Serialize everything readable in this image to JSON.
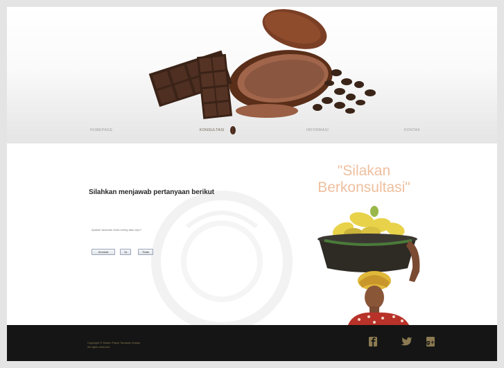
{
  "header": {
    "nav": [
      {
        "label": "Homepage"
      },
      {
        "label": "Konsultasi"
      },
      {
        "label": "Informasi"
      },
      {
        "label": "Kontak"
      }
    ],
    "active_index": 1
  },
  "main": {
    "question_title": "Silahkan menjawab pertanyaan berikut",
    "question_text": "Apakah tanaman Anda kering atau layu?",
    "buttons": {
      "back_label": "Kembali",
      "yes_label": "Ya",
      "no_label": "Tidak"
    },
    "promo": {
      "title": "\"Silakan Berkonsultasi\""
    }
  },
  "footer": {
    "copyright": "Copyright © Sistem Pakar Tanaman Kakao",
    "credit": "All rights reserved"
  },
  "colors": {
    "accent": "#efbf9e",
    "footer_bg": "#151515",
    "footer_text": "#8b7a52"
  },
  "icons": {
    "social": [
      "facebook-icon",
      "twitter-icon",
      "google-plus-icon"
    ]
  }
}
